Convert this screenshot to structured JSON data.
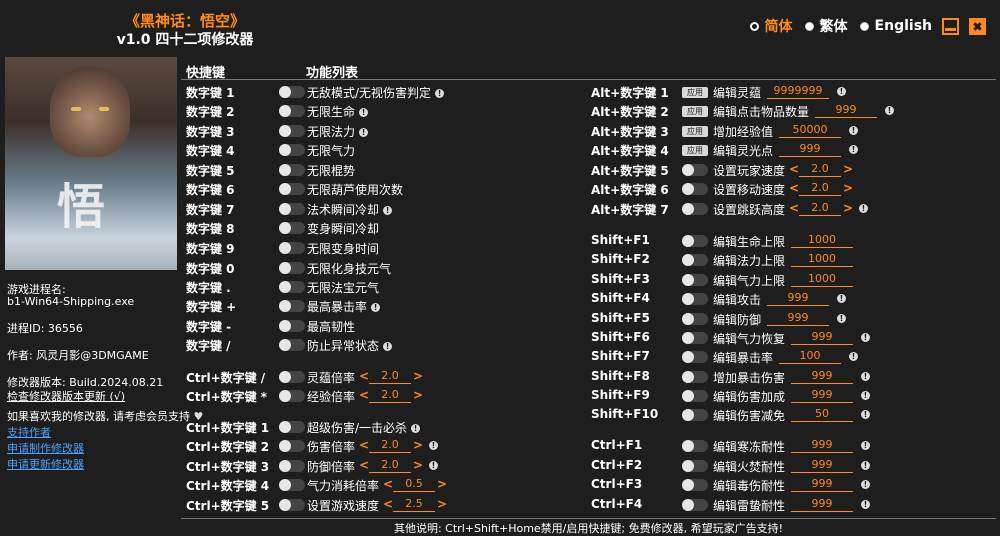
{
  "header": {
    "title": "《黑神话：悟空》",
    "subtitle": "v1.0 四十二项修改器",
    "languages": [
      "简体",
      "繁体",
      "English"
    ],
    "active_language": "简体"
  },
  "info": {
    "process_label": "游戏进程名:",
    "process_name": "b1-Win64-Shipping.exe",
    "pid": "进程ID:   36556",
    "author": "作者:  风灵月影@3DMGAME",
    "version": "修改器版本:  Build.2024.08.21",
    "check_update": "检查修改器版本更新 (√)",
    "support_text": "如果喜欢我的修改器, 请考虑会员支持",
    "links": [
      "支持作者",
      "申请制作修改器",
      "申请更新修改器"
    ]
  },
  "columns": {
    "hotkey": "快捷键",
    "features": "功能列表"
  },
  "left_rows": [
    {
      "key": "数字键 1",
      "label": "无敌模式/无视伤害判定",
      "info": true
    },
    {
      "key": "数字键 2",
      "label": "无限生命",
      "info": true
    },
    {
      "key": "数字键 3",
      "label": "无限法力",
      "info": true
    },
    {
      "key": "数字键 4",
      "label": "无限气力",
      "info": false
    },
    {
      "key": "数字键 5",
      "label": "无限棍势",
      "info": false
    },
    {
      "key": "数字键 6",
      "label": "无限葫芦使用次数",
      "info": false
    },
    {
      "key": "数字键 7",
      "label": "法术瞬间冷却",
      "info": true
    },
    {
      "key": "数字键 8",
      "label": "变身瞬间冷却",
      "info": false
    },
    {
      "key": "数字键 9",
      "label": "无限变身时间",
      "info": false
    },
    {
      "key": "数字键 0",
      "label": "无限化身技元气",
      "info": false
    },
    {
      "key": "数字键 .",
      "label": "无限法宝元气",
      "info": false
    },
    {
      "key": "数字键 +",
      "label": "最高暴击率",
      "info": true
    },
    {
      "key": "数字键 -",
      "label": "最高韧性",
      "info": false
    },
    {
      "key": "数字键 /",
      "label": "防止异常状态",
      "info": true
    },
    {
      "key": "Ctrl+数字键 /",
      "label": "灵蕴倍率",
      "value": "2.0",
      "info": false
    },
    {
      "key": "Ctrl+数字键 *",
      "label": "经验倍率",
      "value": "2.0",
      "info": false
    },
    {
      "key": "Ctrl+数字键 1",
      "label": "超级伤害/一击必杀",
      "info": true
    },
    {
      "key": "Ctrl+数字键 2",
      "label": "伤害倍率",
      "value": "2.0",
      "info": true
    },
    {
      "key": "Ctrl+数字键 3",
      "label": "防御倍率",
      "value": "2.0",
      "info": true
    },
    {
      "key": "Ctrl+数字键 4",
      "label": "气力消耗倍率",
      "value": "0.5",
      "info": false
    },
    {
      "key": "Ctrl+数字键 5",
      "label": "设置游戏速度",
      "value": "2.5",
      "info": false
    }
  ],
  "right_rows": [
    {
      "key": "Alt+数字键 1",
      "apply": "应用",
      "label": "编辑灵蕴",
      "value": "9999999",
      "info": true
    },
    {
      "key": "Alt+数字键 2",
      "apply": "应用",
      "label": "编辑点击物品数量",
      "value": "999",
      "info": true
    },
    {
      "key": "Alt+数字键 3",
      "apply": "应用",
      "label": "增加经验值",
      "value": "50000",
      "info": true
    },
    {
      "key": "Alt+数字键 4",
      "apply": "应用",
      "label": "编辑灵光点",
      "value": "999",
      "info": true
    },
    {
      "key": "Alt+数字键 5",
      "label": "设置玩家速度",
      "value": "2.0",
      "info": false
    },
    {
      "key": "Alt+数字键 6",
      "label": "设置移动速度",
      "value": "2.0",
      "info": false
    },
    {
      "key": "Alt+数字键 7",
      "label": "设置跳跃高度",
      "value": "2.0",
      "info": true
    },
    {
      "key": "Shift+F1",
      "label": "编辑生命上限",
      "value": "1000",
      "info": false
    },
    {
      "key": "Shift+F2",
      "label": "编辑法力上限",
      "value": "1000",
      "info": false
    },
    {
      "key": "Shift+F3",
      "label": "编辑气力上限",
      "value": "1000",
      "info": false
    },
    {
      "key": "Shift+F4",
      "label": "编辑攻击",
      "value": "999",
      "info": true
    },
    {
      "key": "Shift+F5",
      "label": "编辑防御",
      "value": "999",
      "info": true
    },
    {
      "key": "Shift+F6",
      "label": "编辑气力恢复",
      "value": "999",
      "info": true
    },
    {
      "key": "Shift+F7",
      "label": "编辑暴击率",
      "value": "100",
      "info": true
    },
    {
      "key": "Shift+F8",
      "label": "增加暴击伤害",
      "value": "999",
      "info": true
    },
    {
      "key": "Shift+F9",
      "label": "编辑伤害加成",
      "value": "999",
      "info": true
    },
    {
      "key": "Shift+F10",
      "label": "编辑伤害减免",
      "value": "50",
      "info": true
    },
    {
      "key": "Ctrl+F1",
      "label": "编辑寒冻耐性",
      "value": "999",
      "info": true
    },
    {
      "key": "Ctrl+F2",
      "label": "编辑火焚耐性",
      "value": "999",
      "info": true
    },
    {
      "key": "Ctrl+F3",
      "label": "编辑毒伤耐性",
      "value": "999",
      "info": true
    },
    {
      "key": "Ctrl+F4",
      "label": "编辑雷蛰耐性",
      "value": "999",
      "info": true
    }
  ],
  "footer": "其他说明: Ctrl+Shift+Home禁用/启用快捷键; 免费修改器, 希望玩家广告支持!",
  "colors": {
    "accent": "#ff8a1c",
    "background": "#1e1e1e",
    "link": "#4aa3ff"
  }
}
